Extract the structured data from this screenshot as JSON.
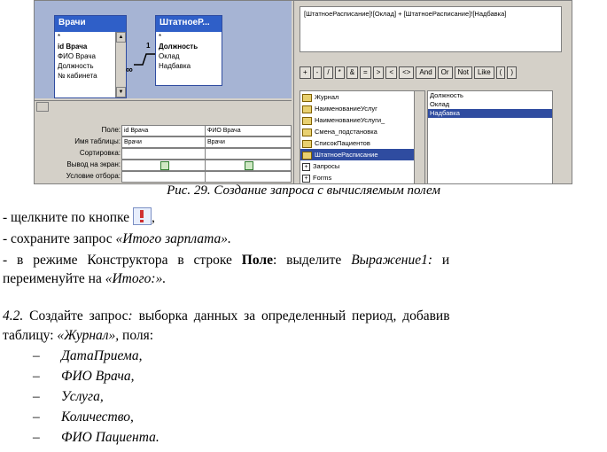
{
  "screenshot": {
    "tables": {
      "vrachi": {
        "title": "Врачи",
        "fields": [
          "*",
          "id Врача",
          "ФИО Врача",
          "Должность",
          "№ кабинета"
        ]
      },
      "shtat": {
        "title": "ШтатноеР...",
        "fields": [
          "*",
          "Должность",
          "Оклад",
          "Надбавка"
        ]
      },
      "rel_one": "1",
      "rel_many": "∞"
    },
    "grid": {
      "row_labels": [
        "Поле:",
        "Имя таблицы:",
        "Сортировка:",
        "Вывод на экран:",
        "Условие отбора:"
      ],
      "col1": {
        "field": "id Врача",
        "table": "Врачи"
      },
      "col2": {
        "field": "ФИО Врача",
        "table": "Врачи"
      }
    },
    "expression": "[ШтатноеРасписание]![Оклад] + [ШтатноеРасписание]![Надбавка]",
    "operators": [
      "+",
      "-",
      "/",
      "*",
      "&",
      "=",
      ">",
      "<",
      "<>",
      "And",
      "Or",
      "Not",
      "Like",
      "(",
      ")"
    ],
    "folders": [
      "Журнал",
      "НаименованиеУслуг",
      "НаименованиеУслуги_",
      "Смена_подстановка",
      "СписокПациентов",
      "ШтатноеРасписание",
      "Запросы",
      "Forms"
    ],
    "field_list": [
      "Должность",
      "Оклад",
      "Надбавка"
    ]
  },
  "caption": "Рис. 29. Создание запроса с вычисляемым полем",
  "lines": {
    "l1": "- щелкните по кнопке",
    "l1_end": ",",
    "l2a": "- сохраните запрос ",
    "l2b": "«Итого зарплата».",
    "l3a": "- в режиме Конструктора в строке ",
    "l3b": "Поле",
    "l3c": ": выделите ",
    "l3d": "Выражение1:",
    "l3e": " и",
    "l4a": "переименуйте на ",
    "l4b": "«Итого:».",
    "l5a": "4.2.",
    "l5b": " Создайте запрос",
    "l5c": ":",
    "l5d": " выборка данных за определенный период, добавив",
    "l6a": "таблицу: ",
    "l6b": "«Журнал»,",
    "l6c": " поля:",
    "items": [
      "ДатаПриема,",
      "ФИО Врача,",
      "Услуга,",
      "Количество,",
      "ФИО Пациента."
    ],
    "dash": "–"
  }
}
